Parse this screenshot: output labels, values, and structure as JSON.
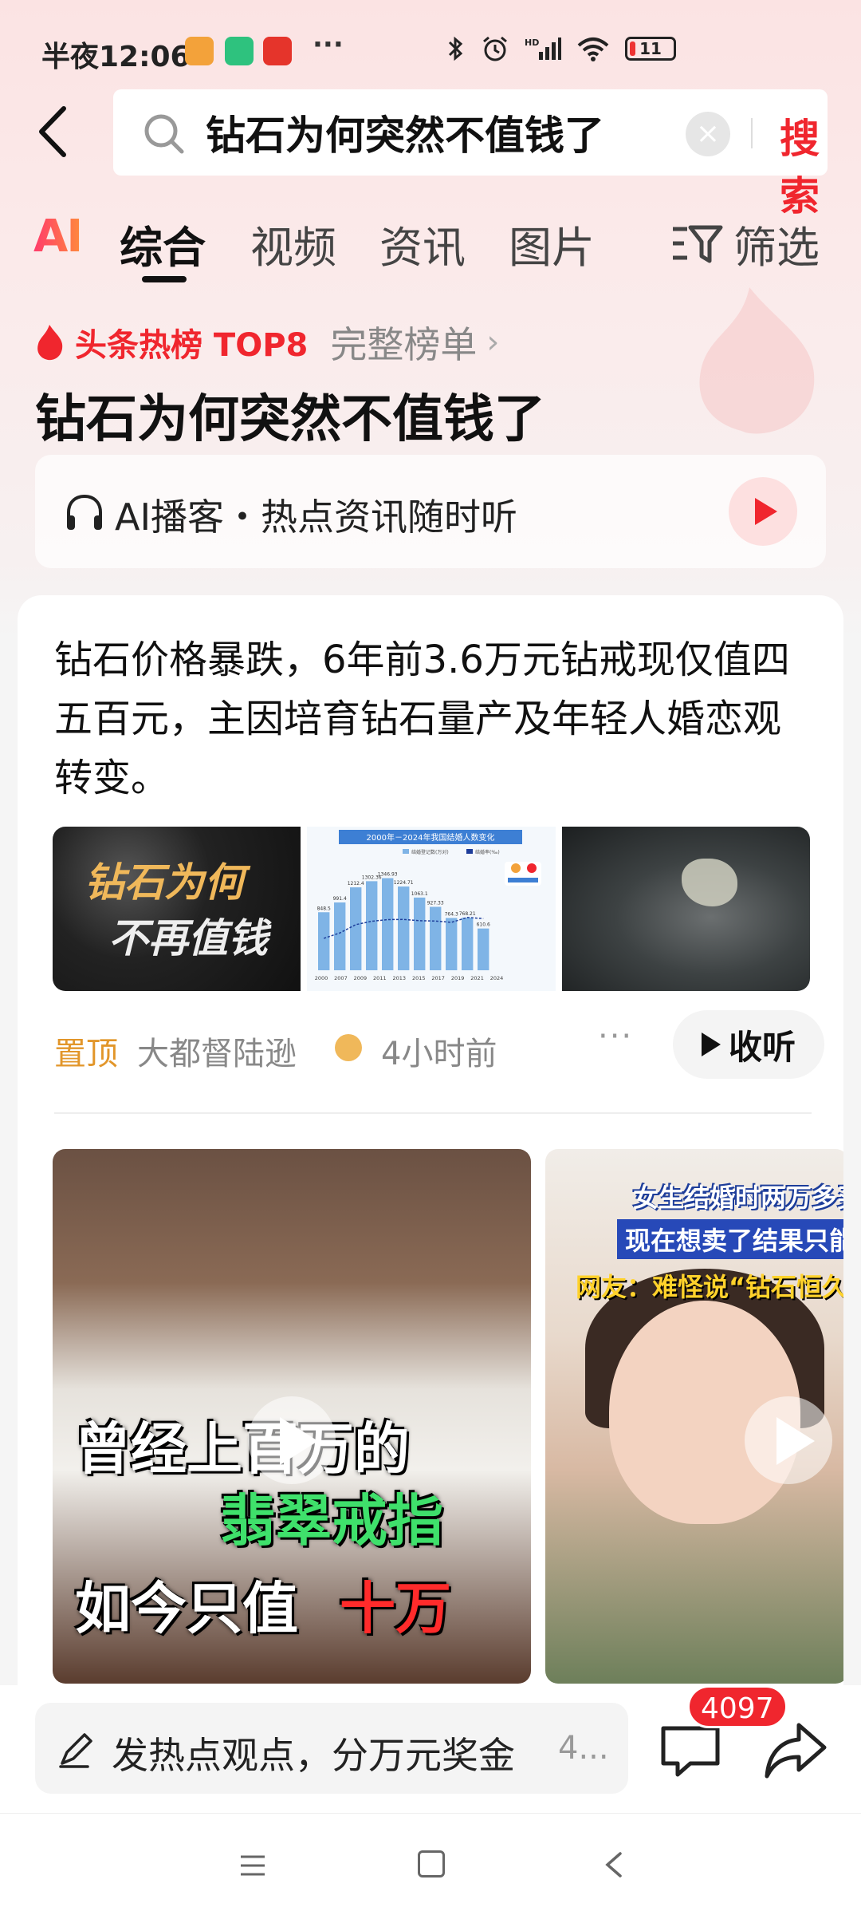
{
  "status_bar": {
    "time": "半夜12:06",
    "more": "···",
    "battery": "11",
    "battery_level": 0.11
  },
  "search": {
    "value": "钻石为何突然不值钱了",
    "clear": "×",
    "button": "搜索"
  },
  "tabs": {
    "ai": "AI",
    "items": [
      "综合",
      "视频",
      "资讯",
      "图片"
    ],
    "active": "综合",
    "filter": "筛选"
  },
  "hot": {
    "label": "头条热榜 TOP8",
    "full_list": "完整榜单",
    "arrow": "›",
    "topic": "钻石为何突然不值钱了"
  },
  "podcast": {
    "text": "AI播客・热点资讯随时听"
  },
  "card": {
    "summary": "钻石价格暴跌，6年前3.6万元钻戒现仅值四五百元，主因培育钻石量产及年轻人婚恋观转变。",
    "thumb1_line1": "钻石为何",
    "thumb1_line2": "不再值钱",
    "chart_thumb": {
      "title": "2000年－2024年我国结婚人数变化",
      "legend": [
        "结婚登记数(万对)",
        "结婚率(‰)"
      ],
      "x": [
        "2000",
        "2007",
        "2009",
        "2011",
        "2013",
        "2015",
        "2017",
        "2019",
        "2021",
        "2024"
      ],
      "bar_labels": [
        "848.5",
        "991.4",
        "1212.4",
        "1302.36",
        "1346.93",
        "1224.71",
        "1063.1",
        "927.33",
        "764.3",
        "768.21",
        "610.6"
      ]
    },
    "pin": "置顶",
    "author": "大都督陆逊",
    "time_ago": "4小时前",
    "more": "···",
    "listen": "收听"
  },
  "videos": [
    {
      "captions": [
        "曾经上百万的",
        "翡翠戒指",
        "如今只值",
        "十万"
      ]
    },
    {
      "captions": [
        "女生结婚时两万多买",
        "现在想卖了结果只能",
        "网友：难怪说“钻石恒久远，"
      ]
    }
  ],
  "bottom": {
    "comment_placeholder": "发热点观点，分万元奖金",
    "comment_more": "4...",
    "badge_count": "4097"
  },
  "colors": {
    "accent": "#f0262e",
    "pin": "#e2962a"
  }
}
